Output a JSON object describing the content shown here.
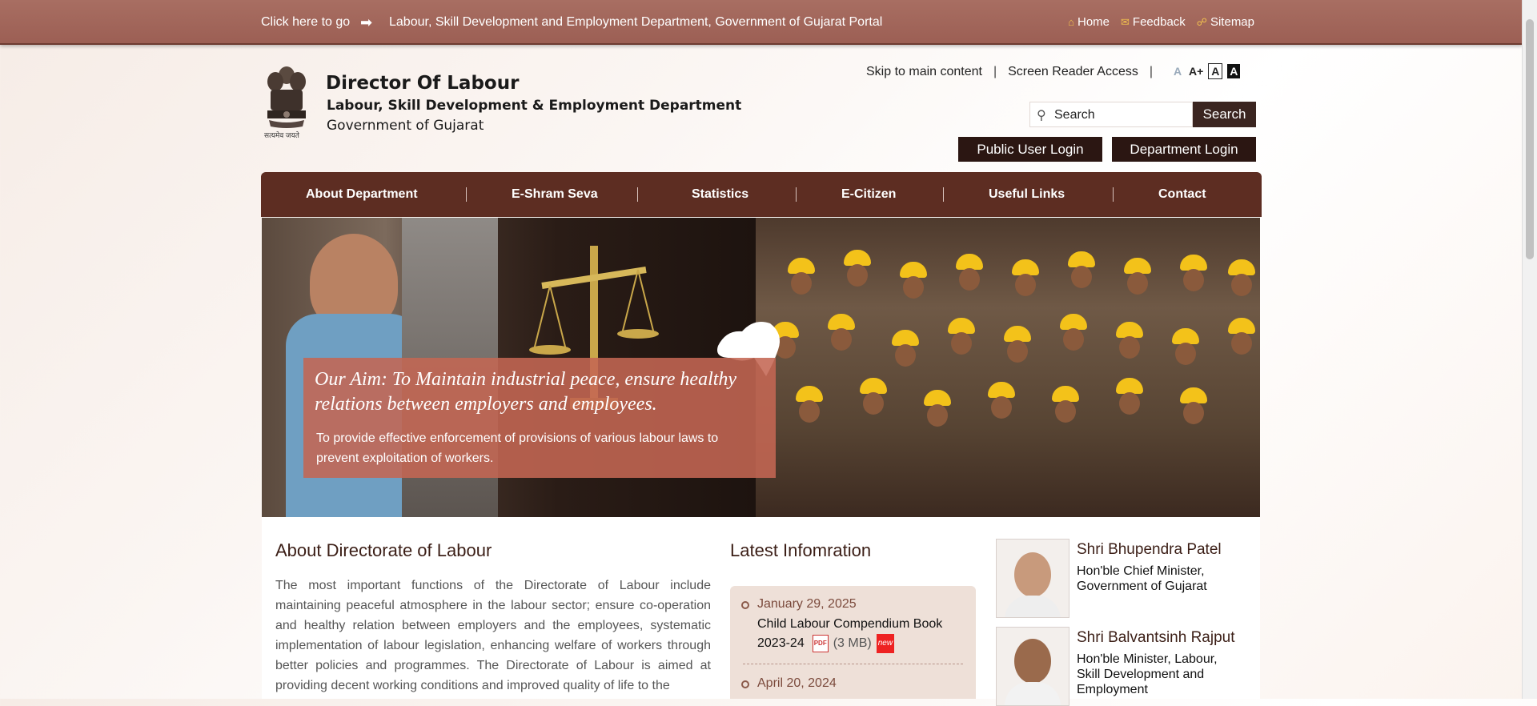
{
  "topbar": {
    "click_text": "Click here to go",
    "portal_link": "Labour, Skill Development and Employment Department, Government of Gujarat Portal",
    "home": "Home",
    "feedback": "Feedback",
    "sitemap": "Sitemap"
  },
  "header": {
    "title": "Director Of Labour",
    "department": "Labour, Skill Development & Employment Department",
    "government": "Government of Gujarat",
    "emblem_caption": "सत्यमेव जयते"
  },
  "utility": {
    "skip": "Skip to main content",
    "screen_reader": "Screen Reader Access",
    "font_small": "A",
    "font_large": "A+",
    "contrast_normal": "A",
    "contrast_dark": "A"
  },
  "search": {
    "placeholder": "Search",
    "button": "Search"
  },
  "login": {
    "public": "Public User Login",
    "department": "Department Login"
  },
  "nav": [
    {
      "label": "About Department"
    },
    {
      "label": "E-Shram Seva"
    },
    {
      "label": "Statistics"
    },
    {
      "label": "E-Citizen"
    },
    {
      "label": "Useful Links"
    },
    {
      "label": "Contact"
    }
  ],
  "banner": {
    "aim": "Our Aim: To Maintain industrial peace, ensure healthy relations between employers and employees.",
    "text": "To provide effective enforcement of provisions of various labour laws to prevent exploitation of workers."
  },
  "about": {
    "title": "About Directorate of Labour",
    "text": "The most important functions of the Directorate of Labour include maintaining peaceful atmosphere in the labour sector; ensure co-operation and healthy relation between employers and the employees, systematic implementation of labour legislation, enhancing welfare of workers through better policies and programmes. The Directorate of Labour is aimed at providing decent working conditions and improved quality of life to the"
  },
  "latest": {
    "title": "Latest Infomration",
    "items": [
      {
        "date": "January 29, 2025",
        "text": "Child Labour Compendium Book 2023-24",
        "size": "(3 MB)",
        "pdf": "PDF",
        "new": "new"
      },
      {
        "date": "April 20, 2024"
      }
    ]
  },
  "ministers": [
    {
      "name": "Shri Bhupendra Patel",
      "role": "Hon'ble Chief Minister, Government of Gujarat"
    },
    {
      "name": "Shri Balvantsinh Rajput",
      "role": "Hon'ble Minister, Labour, Skill Development and Employment"
    }
  ],
  "colors": {
    "topbar": "#a0645a",
    "nav": "#5d2d22",
    "login": "#2b1612",
    "banner_overlay": "#c46753"
  }
}
